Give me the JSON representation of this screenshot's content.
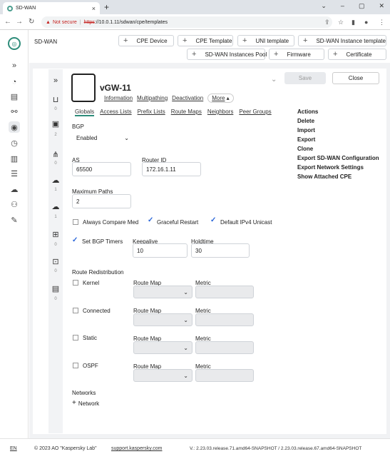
{
  "browser": {
    "tab_title": "SD-WAN",
    "not_secure": "Not secure",
    "url_scheme": "https",
    "url_rest": "://10.0.1.11/sdwan/cpe/templates"
  },
  "header": {
    "app_title": "SD-WAN",
    "buttons": [
      "CPE Device",
      "CPE Template",
      "UNI template",
      "SD-WAN Instance template",
      "SD-WAN Instances Pool",
      "Firmware",
      "Certificate"
    ]
  },
  "side_counts": [
    "0",
    "2",
    "0",
    "1",
    "1",
    "0",
    "0",
    "0"
  ],
  "template": {
    "name": "vGW-11",
    "links": [
      "Information",
      "Multipathing",
      "Deactivation"
    ],
    "more_label": "More",
    "save_label": "Save",
    "close_label": "Close"
  },
  "tabs": [
    "Globals",
    "Access Lists",
    "Prefix Lists",
    "Route Maps",
    "Neighbors",
    "Peer Groups"
  ],
  "form": {
    "bgp_label": "BGP",
    "bgp_value": "Enabled",
    "as_label": "AS",
    "as_value": "65500",
    "router_id_label": "Router ID",
    "router_id_value": "172.16.1.11",
    "max_paths_label": "Maximum Paths",
    "max_paths_value": "2",
    "always_compare_med": "Always Compare Med",
    "graceful_restart": "Graceful Restart",
    "default_ipv4": "Default IPv4 Unicast",
    "set_bgp_timers": "Set BGP Timers",
    "keepalive_label": "Keepalive",
    "keepalive_value": "10",
    "holdtime_label": "Holdtime",
    "holdtime_value": "30",
    "redistribution_label": "Route Redistribution",
    "redistribution": [
      {
        "name": "Kernel",
        "route_map": "Route Map",
        "metric": "Metric"
      },
      {
        "name": "Connected",
        "route_map": "Route Map",
        "metric": "Metric"
      },
      {
        "name": "Static",
        "route_map": "Route Map",
        "metric": "Metric"
      },
      {
        "name": "OSPF",
        "route_map": "Route Map",
        "metric": "Metric"
      }
    ],
    "networks_label": "Networks",
    "add_network": "Network"
  },
  "actions": {
    "title": "Actions",
    "items": [
      "Delete",
      "Import",
      "Export",
      "Clone",
      "Export SD-WAN Configuration",
      "Export Network Settings",
      "Show Attached CPE"
    ]
  },
  "footer": {
    "lang": "EN",
    "copyright": "© 2023 AO \"Kaspersky Lab\"",
    "support": "support.kaspersky.com",
    "version": "V.: 2.23.03.release.71.amd64-SNAPSHOT / 2.23.03.release.67.amd64-SNAPSHOT"
  }
}
